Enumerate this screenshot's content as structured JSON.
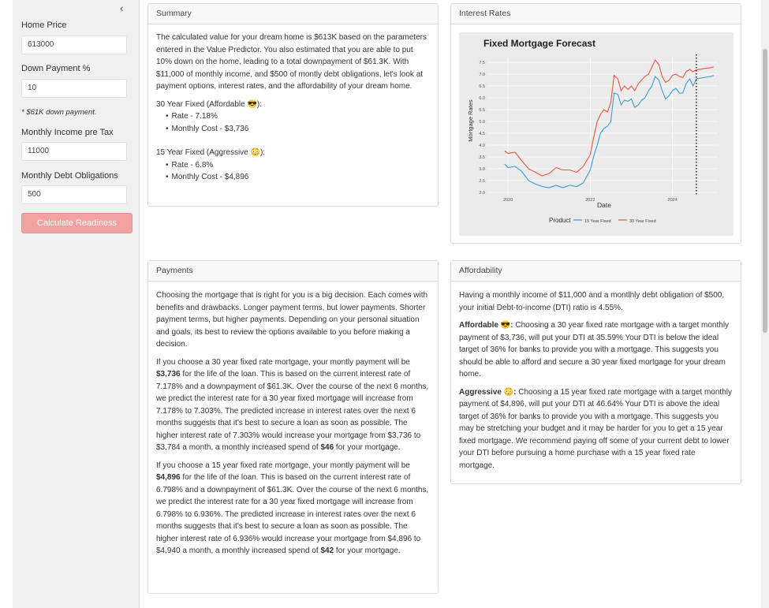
{
  "sidebar": {
    "collapse_icon": "‹",
    "home_price_label": "Home Price",
    "home_price_value": "613000",
    "down_payment_label": "Down Payment %",
    "down_payment_value": "10",
    "down_payment_note": "* $61K down payment.",
    "income_label": "Monthly Income pre Tax",
    "income_value": "11000",
    "debt_label": "Monthly Debt Obligations",
    "debt_value": "500",
    "calculate_button": "Calculate Readiness",
    "button_color": "#f2a0a0"
  },
  "summary": {
    "title": "Summary",
    "intro": "The calculated value for your dream home is $613K based on the parameters entered in the Value Predictor. You also estimated that you are able to put 10% down on the home, leading to a total downpayment of $61.3K. With $11,000 of monthly income, and $500 of montly debt obligations, let's look at payment options, interest rates, and the affordability of your dream home.",
    "option1_title": "30 Year Fixed (Affordable ",
    "option1_emoji": "😎",
    "option1_close": "):",
    "option1_rate": "Rate - 7.18%",
    "option1_cost": "Monthly Cost - $3,736",
    "option2_title": "15 Year Fixed (Aggressive ",
    "option2_emoji": "😳",
    "option2_close": "):",
    "option2_rate": "Rate - 6.8%",
    "option2_cost": "Monthly Cost - $4,896"
  },
  "interest": {
    "title": "Interest Rates"
  },
  "payments": {
    "title": "Payments",
    "p1": "Choosing the mortgage that is right for you is a big decision. Each comes with benefits and drawbacks. Longer payment terms, but lower payments. Shorter payment terms, but higher payments. Depending on your personal situation and goals, its best to review the options available to you before making a decision.",
    "p2_a": "If you choose a 30 year fixed rate mortgage, your montly payment will be ",
    "p2_b": "$3,736",
    "p2_c": " for the life of the loan. This is based on the current interest rate of 7.178% and a downpayment of $61.3K. Over the course of the next 6 months, we predict the interest rate for a 30 year fixed mortgage will increase from 7.178% to 7.303%. The predicted increase in interest rates over the next 6 months suggests that it's best to secure a loan as soon as possible. The higher interest rate of 7.303% would increase your mortgage from $3,736 to $3,784 a month, a monthly increased spend of ",
    "p2_d": "$46",
    "p2_e": " for your mortgage.",
    "p3_a": "If you choose a 15 year fixed rate mortgage, your montly payment will be ",
    "p3_b": "$4,896",
    "p3_c": " for the life of the loan. This is based on the current interest rate of 6.798% and a downpayment of $61.3K. Over the course of the next 6 months, we predict the interest rate for a 30 year fixed mortgage will increase from 6.798% to 6.936%. The predicted increase in interest rates over the next 6 months suggests that it's best to secure a loan as soon as possible. The higher interest rate of 6.936% would increase your mortgage from $4,896 to $4,940 a month, a monthly increased spend of ",
    "p3_d": "$42",
    "p3_e": " for your mortgage."
  },
  "affordability": {
    "title": "Affordability",
    "p1": "Having a monthly income of $11,000 and a montlhly debt obligation of $500, your initial Debt-to-income (DTI) ratio is 4.55%.",
    "aff_label": "Affordable ",
    "aff_emoji": "😎",
    "aff_colon": ":",
    "aff_text": " Choosing a 30 year fixed rate mortgage with a target monthly payment of $3,736, will put your DTI at 35.59% Your DTI is below the ideal target of 36% for banks to provide you with a mortgage. This suggests you should be able to afford and secure a 30 year fixed mortgage for your dream home.",
    "agg_label": "Aggressive ",
    "agg_emoji": "😳",
    "agg_colon": ":",
    "agg_text": " Choosing a 15 year fixed rate mortgage with a target monthly payment of $4,896, will put your DTI at 46.64% Your DTI is above the ideal target of 36% for banks to provide you with a mortgage. This suggests you may be stretching your budget and it may be harder for you to get a 15 year fixed mortgage. We recommend paying off some of your current debt to lower your DTI before pursuing a home purchase with a 15 year fixed rate mortgage."
  },
  "chart_data": {
    "type": "line",
    "title": "Fixed Mortgage Forecast",
    "xlabel": "Date",
    "ylabel": "Mortgage Rates",
    "xlim": [
      2019.5,
      2025.1
    ],
    "ylim": [
      1.9,
      7.7
    ],
    "yticks": [
      "2.0",
      "2.5",
      "3.0",
      "3.5",
      "4.0",
      "4.5",
      "5.0",
      "5.5",
      "6.0",
      "6.5",
      "7.0",
      "7.5"
    ],
    "xticks": [
      "2020",
      "2022",
      "2024"
    ],
    "xtick_values": [
      2020,
      2022,
      2024
    ],
    "forecast_start": 2024.58,
    "legend_title": "Product",
    "legend_position": "bottom",
    "grid": true,
    "series": [
      {
        "name": "15 Year Fixed",
        "color": "#3a9ad9",
        "x": [
          2019.92,
          2020.0,
          2020.17,
          2020.33,
          2020.5,
          2020.67,
          2020.83,
          2021.0,
          2021.17,
          2021.33,
          2021.5,
          2021.67,
          2021.83,
          2022.0,
          2022.08,
          2022.17,
          2022.25,
          2022.33,
          2022.42,
          2022.5,
          2022.58,
          2022.67,
          2022.75,
          2022.83,
          2022.92,
          2023.0,
          2023.08,
          2023.17,
          2023.25,
          2023.33,
          2023.42,
          2023.5,
          2023.58,
          2023.67,
          2023.75,
          2023.83,
          2023.92,
          2024.0,
          2024.08,
          2024.17,
          2024.25,
          2024.33,
          2024.42,
          2024.5,
          2024.58,
          2024.75,
          2024.92,
          2025.0
        ],
        "values": [
          3.2,
          3.05,
          3.1,
          2.9,
          2.5,
          2.35,
          2.25,
          2.2,
          2.3,
          2.2,
          2.3,
          2.25,
          2.4,
          2.95,
          3.5,
          4.0,
          4.5,
          4.7,
          4.8,
          5.0,
          6.2,
          6.15,
          5.7,
          5.9,
          5.85,
          5.95,
          5.6,
          5.7,
          5.9,
          6.0,
          6.3,
          6.5,
          6.9,
          6.75,
          6.3,
          5.95,
          6.1,
          6.3,
          6.4,
          6.2,
          6.2,
          6.6,
          6.8,
          6.5,
          6.8,
          6.85,
          6.9,
          6.94
        ]
      },
      {
        "name": "30 Year Fixed",
        "color": "#e8553f",
        "x": [
          2019.92,
          2020.0,
          2020.17,
          2020.33,
          2020.5,
          2020.67,
          2020.83,
          2021.0,
          2021.17,
          2021.33,
          2021.5,
          2021.67,
          2021.83,
          2022.0,
          2022.08,
          2022.17,
          2022.25,
          2022.33,
          2022.42,
          2022.5,
          2022.58,
          2022.67,
          2022.75,
          2022.83,
          2022.92,
          2023.0,
          2023.08,
          2023.17,
          2023.25,
          2023.33,
          2023.42,
          2023.5,
          2023.58,
          2023.67,
          2023.75,
          2023.83,
          2023.92,
          2024.0,
          2024.08,
          2024.17,
          2024.25,
          2024.33,
          2024.42,
          2024.5,
          2024.58,
          2024.75,
          2024.92,
          2025.0
        ],
        "values": [
          3.75,
          3.65,
          3.7,
          3.35,
          3.0,
          2.85,
          2.7,
          2.8,
          3.05,
          2.95,
          2.95,
          2.85,
          3.1,
          3.6,
          4.3,
          5.0,
          5.3,
          5.5,
          5.4,
          5.8,
          6.95,
          6.8,
          6.3,
          6.5,
          6.35,
          6.5,
          6.3,
          6.6,
          6.75,
          6.9,
          7.0,
          7.3,
          7.6,
          7.4,
          6.9,
          6.65,
          6.75,
          6.95,
          7.0,
          6.9,
          6.85,
          7.1,
          7.2,
          7.1,
          7.18,
          7.23,
          7.27,
          7.3
        ]
      }
    ]
  }
}
